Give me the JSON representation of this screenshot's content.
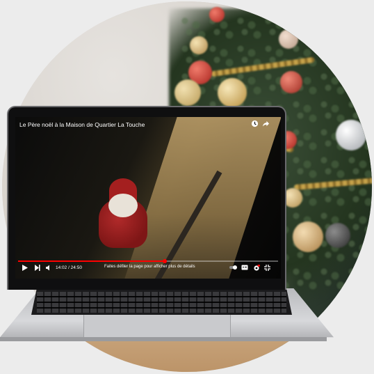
{
  "video": {
    "title": "Le Père noël à la Maison de Quartier La Touche",
    "time_display": "14:02 / 24:50",
    "scroll_hint": "Faites défiler la page pour afficher plus de détails",
    "progress": 0.565
  },
  "icons": {
    "watch_later": "clock-icon",
    "share": "share-icon",
    "play": "play-icon",
    "next": "next-icon",
    "volume": "volume-icon",
    "autoplay": "autoplay-toggle-icon",
    "subtitles": "subtitles-icon",
    "settings": "settings-icon",
    "exit_fullscreen": "exit-fullscreen-icon"
  },
  "colors": {
    "progress": "#ff0000",
    "santa_red": "#a41f1f"
  }
}
